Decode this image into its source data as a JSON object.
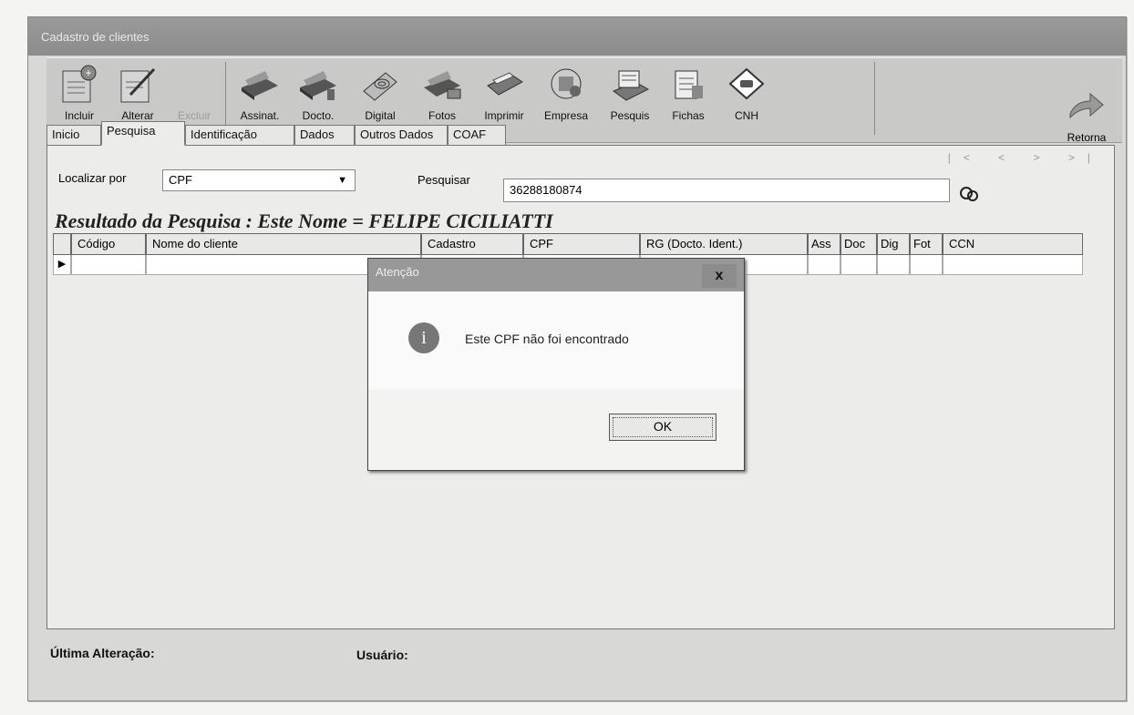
{
  "window": {
    "title": "Cadastro de clientes"
  },
  "toolbar": {
    "items": [
      {
        "label": "Incluir",
        "icon": "add-document-icon",
        "enabled": true
      },
      {
        "label": "Alterar",
        "icon": "edit-document-icon",
        "enabled": true
      },
      {
        "label": "Excluir",
        "icon": "delete-icon",
        "enabled": false
      },
      {
        "label": "Assinat.",
        "icon": "scanner-icon",
        "enabled": true
      },
      {
        "label": "Docto.",
        "icon": "scanner-icon",
        "enabled": true
      },
      {
        "label": "Digital",
        "icon": "fingerprint-scanner-icon",
        "enabled": true
      },
      {
        "label": "Fotos",
        "icon": "camera-scanner-icon",
        "enabled": true
      },
      {
        "label": "Imprimir",
        "icon": "printer-icon",
        "enabled": true
      },
      {
        "label": "Empresa",
        "icon": "company-icon",
        "enabled": true
      },
      {
        "label": "Pesquis",
        "icon": "search-records-icon",
        "enabled": true
      },
      {
        "label": "Fichas",
        "icon": "forms-icon",
        "enabled": true
      },
      {
        "label": "CNH",
        "icon": "driver-license-icon",
        "enabled": true
      }
    ],
    "retorna_label": "Retorna"
  },
  "tabs": [
    "Inicio",
    "Pesquisa",
    "Identificação",
    "Dados",
    "Outros Dados",
    "COAF"
  ],
  "active_tab": "Pesquisa",
  "search": {
    "localizar_label": "Localizar por",
    "localizar_value": "CPF",
    "pesquisar_label": "Pesquisar",
    "pesquisar_value": "36288180874"
  },
  "result_title": "Resultado da Pesquisa : Este Nome = FELIPE CICILIATTI",
  "grid": {
    "columns": [
      "Código",
      "Nome do cliente",
      "Cadastro",
      "CPF",
      "RG (Docto. Ident.)",
      "Ass",
      "Doc",
      "Dig",
      "Fot",
      "CCN"
    ]
  },
  "status": {
    "ultima_label": "Última Alteração:",
    "usuario_label": "Usuário:"
  },
  "dialog": {
    "title": "Atenção",
    "message": "Este CPF não foi encontrado",
    "ok_label": "OK",
    "close_label": "x"
  },
  "colors": {
    "title_bar": "#8c8c8c",
    "window_bg": "#d8d8d6",
    "content_bg": "#ececea"
  }
}
